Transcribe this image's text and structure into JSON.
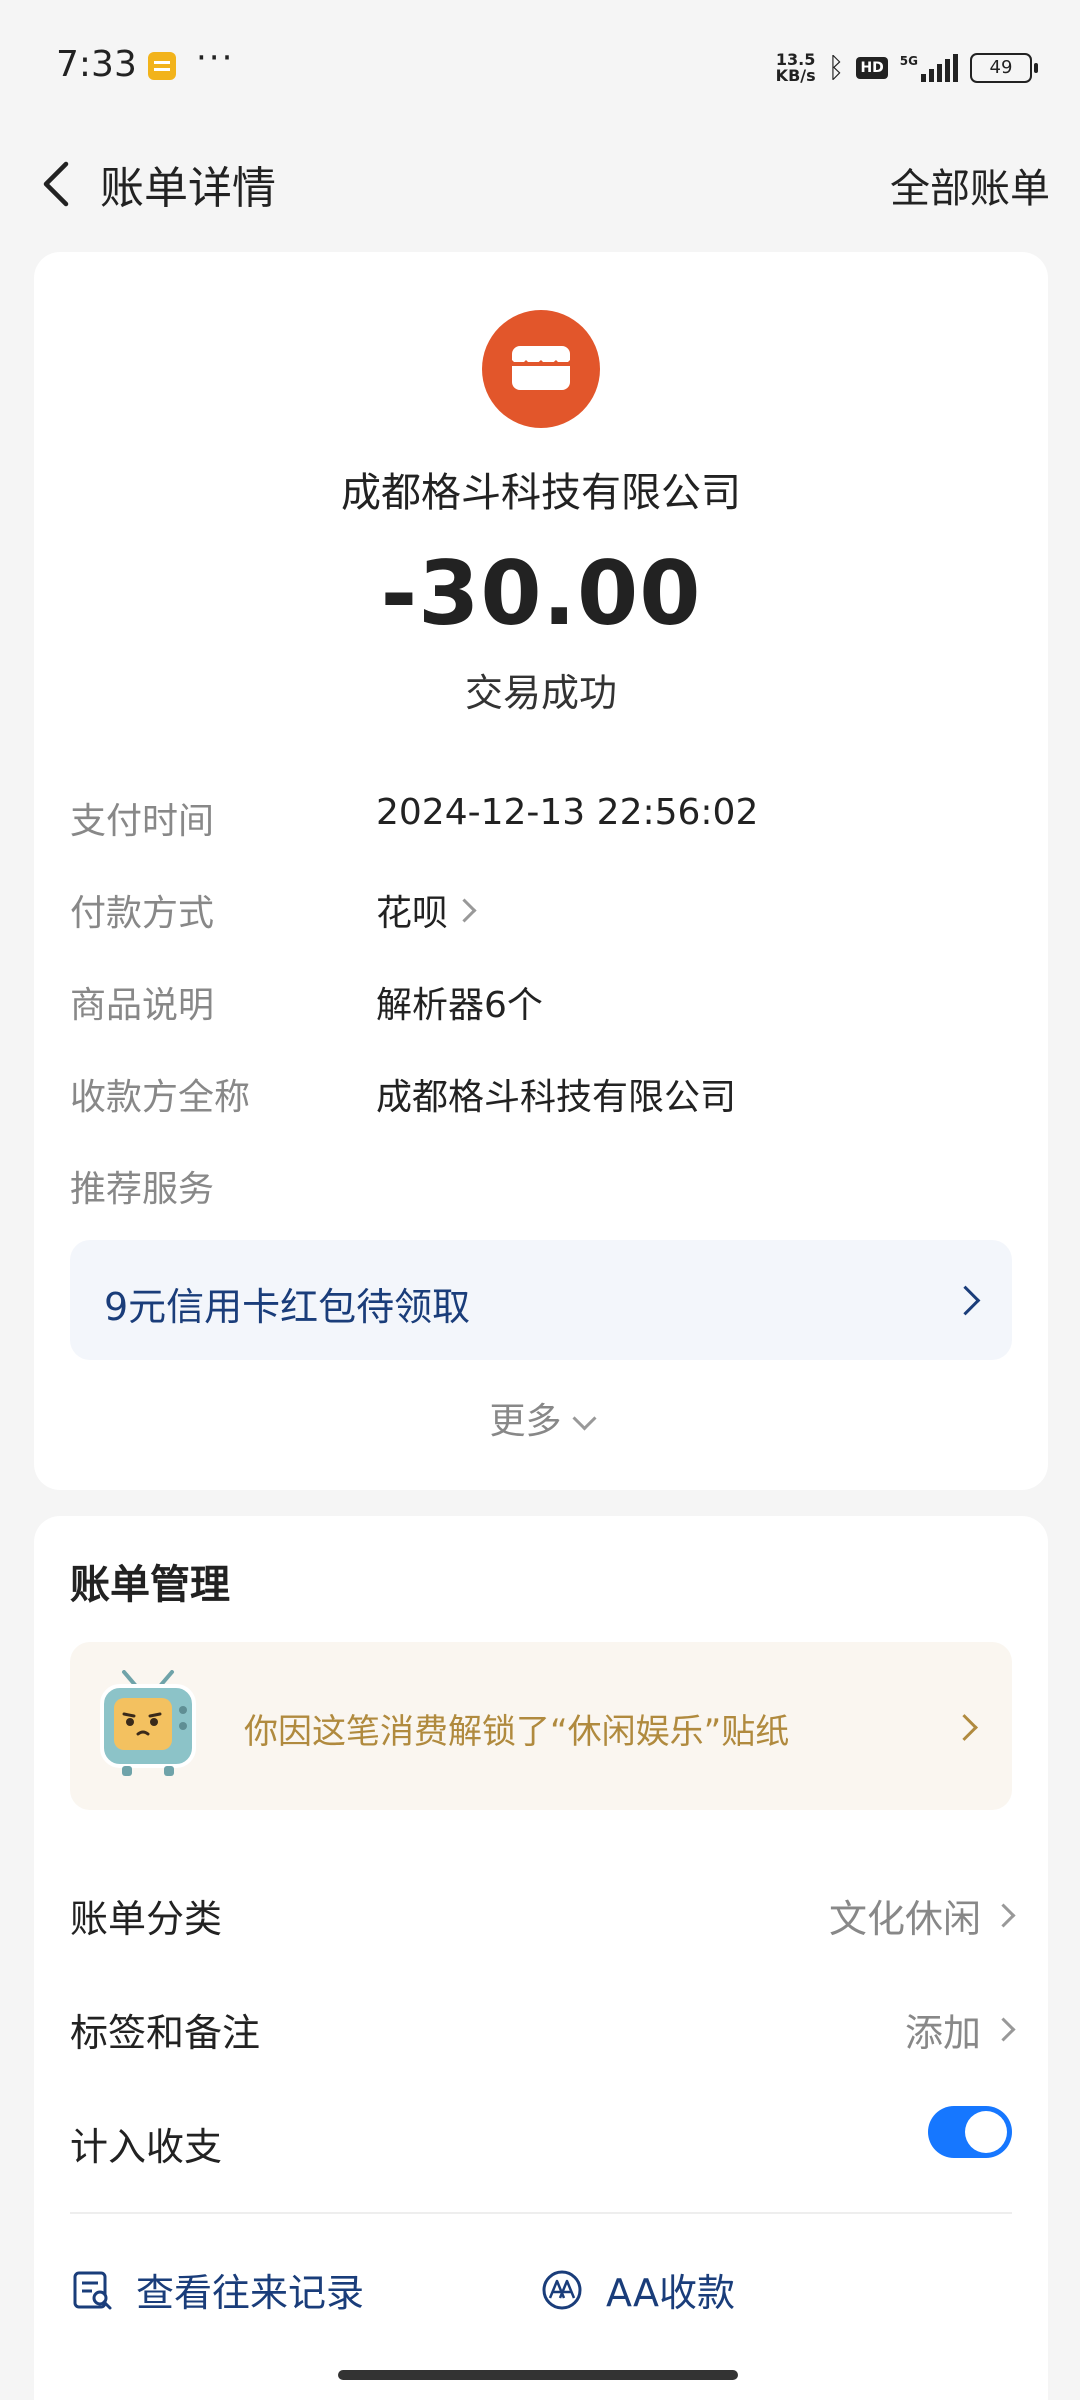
{
  "status_bar": {
    "time": "7:33",
    "net_speed_value": "13.5",
    "net_speed_unit": "KB/s",
    "network": "5G",
    "hd_badge": "HD",
    "battery": "49"
  },
  "header": {
    "title": "账单详情",
    "all_bills": "全部账单"
  },
  "bill": {
    "merchant": "成都格斗科技有限公司",
    "amount": "-30.00",
    "status": "交易成功",
    "details": [
      {
        "label": "支付时间",
        "value": "2024-12-13 22:56:02"
      },
      {
        "label": "付款方式",
        "value": "花呗"
      },
      {
        "label": "商品说明",
        "value": "解析器6个"
      },
      {
        "label": "收款方全称",
        "value": "成都格斗科技有限公司"
      },
      {
        "label": "推荐服务",
        "value": ""
      }
    ],
    "promo": "9元信用卡红包待领取",
    "more": "更多"
  },
  "management": {
    "title": "账单管理",
    "sticker_text": "你因这笔消费解锁了“休闲娱乐”贴纸",
    "rows": [
      {
        "label": "账单分类",
        "value": "文化休闲"
      },
      {
        "label": "标签和备注",
        "value": "添加"
      },
      {
        "label": "计入收支",
        "toggle": true
      }
    ],
    "actions": [
      {
        "label": "查看往来记录",
        "icon": "records-icon"
      },
      {
        "label": "AA收款",
        "icon": "aa-icon"
      }
    ]
  },
  "colors": {
    "accent": "#1677ff",
    "merchant_avatar": "#e2562b",
    "promo_text": "#1a3d7a",
    "sticker_text": "#b08a3e"
  }
}
